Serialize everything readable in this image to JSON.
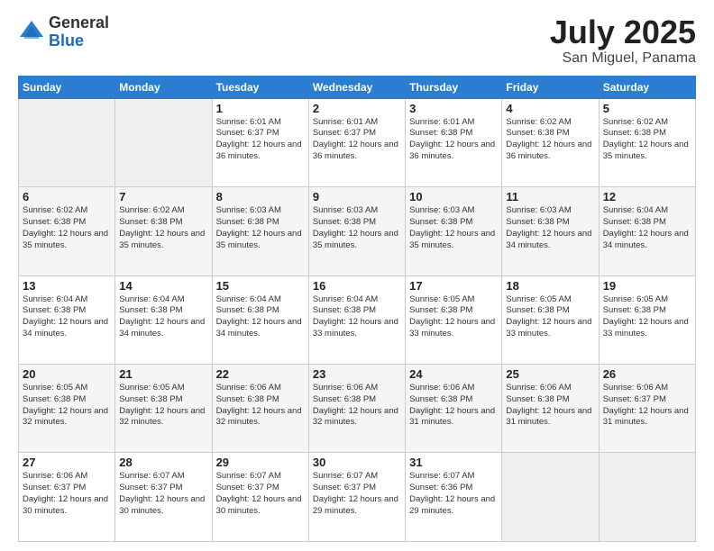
{
  "header": {
    "logo_general": "General",
    "logo_blue": "Blue",
    "title": "July 2025",
    "location": "San Miguel, Panama"
  },
  "weekdays": [
    "Sunday",
    "Monday",
    "Tuesday",
    "Wednesday",
    "Thursday",
    "Friday",
    "Saturday"
  ],
  "weeks": [
    [
      {
        "day": "",
        "sunrise": "",
        "sunset": "",
        "daylight": "",
        "empty": true
      },
      {
        "day": "",
        "sunrise": "",
        "sunset": "",
        "daylight": "",
        "empty": true
      },
      {
        "day": "1",
        "sunrise": "Sunrise: 6:01 AM",
        "sunset": "Sunset: 6:37 PM",
        "daylight": "Daylight: 12 hours and 36 minutes."
      },
      {
        "day": "2",
        "sunrise": "Sunrise: 6:01 AM",
        "sunset": "Sunset: 6:37 PM",
        "daylight": "Daylight: 12 hours and 36 minutes."
      },
      {
        "day": "3",
        "sunrise": "Sunrise: 6:01 AM",
        "sunset": "Sunset: 6:38 PM",
        "daylight": "Daylight: 12 hours and 36 minutes."
      },
      {
        "day": "4",
        "sunrise": "Sunrise: 6:02 AM",
        "sunset": "Sunset: 6:38 PM",
        "daylight": "Daylight: 12 hours and 36 minutes."
      },
      {
        "day": "5",
        "sunrise": "Sunrise: 6:02 AM",
        "sunset": "Sunset: 6:38 PM",
        "daylight": "Daylight: 12 hours and 35 minutes."
      }
    ],
    [
      {
        "day": "6",
        "sunrise": "Sunrise: 6:02 AM",
        "sunset": "Sunset: 6:38 PM",
        "daylight": "Daylight: 12 hours and 35 minutes."
      },
      {
        "day": "7",
        "sunrise": "Sunrise: 6:02 AM",
        "sunset": "Sunset: 6:38 PM",
        "daylight": "Daylight: 12 hours and 35 minutes."
      },
      {
        "day": "8",
        "sunrise": "Sunrise: 6:03 AM",
        "sunset": "Sunset: 6:38 PM",
        "daylight": "Daylight: 12 hours and 35 minutes."
      },
      {
        "day": "9",
        "sunrise": "Sunrise: 6:03 AM",
        "sunset": "Sunset: 6:38 PM",
        "daylight": "Daylight: 12 hours and 35 minutes."
      },
      {
        "day": "10",
        "sunrise": "Sunrise: 6:03 AM",
        "sunset": "Sunset: 6:38 PM",
        "daylight": "Daylight: 12 hours and 35 minutes."
      },
      {
        "day": "11",
        "sunrise": "Sunrise: 6:03 AM",
        "sunset": "Sunset: 6:38 PM",
        "daylight": "Daylight: 12 hours and 34 minutes."
      },
      {
        "day": "12",
        "sunrise": "Sunrise: 6:04 AM",
        "sunset": "Sunset: 6:38 PM",
        "daylight": "Daylight: 12 hours and 34 minutes."
      }
    ],
    [
      {
        "day": "13",
        "sunrise": "Sunrise: 6:04 AM",
        "sunset": "Sunset: 6:38 PM",
        "daylight": "Daylight: 12 hours and 34 minutes."
      },
      {
        "day": "14",
        "sunrise": "Sunrise: 6:04 AM",
        "sunset": "Sunset: 6:38 PM",
        "daylight": "Daylight: 12 hours and 34 minutes."
      },
      {
        "day": "15",
        "sunrise": "Sunrise: 6:04 AM",
        "sunset": "Sunset: 6:38 PM",
        "daylight": "Daylight: 12 hours and 34 minutes."
      },
      {
        "day": "16",
        "sunrise": "Sunrise: 6:04 AM",
        "sunset": "Sunset: 6:38 PM",
        "daylight": "Daylight: 12 hours and 33 minutes."
      },
      {
        "day": "17",
        "sunrise": "Sunrise: 6:05 AM",
        "sunset": "Sunset: 6:38 PM",
        "daylight": "Daylight: 12 hours and 33 minutes."
      },
      {
        "day": "18",
        "sunrise": "Sunrise: 6:05 AM",
        "sunset": "Sunset: 6:38 PM",
        "daylight": "Daylight: 12 hours and 33 minutes."
      },
      {
        "day": "19",
        "sunrise": "Sunrise: 6:05 AM",
        "sunset": "Sunset: 6:38 PM",
        "daylight": "Daylight: 12 hours and 33 minutes."
      }
    ],
    [
      {
        "day": "20",
        "sunrise": "Sunrise: 6:05 AM",
        "sunset": "Sunset: 6:38 PM",
        "daylight": "Daylight: 12 hours and 32 minutes."
      },
      {
        "day": "21",
        "sunrise": "Sunrise: 6:05 AM",
        "sunset": "Sunset: 6:38 PM",
        "daylight": "Daylight: 12 hours and 32 minutes."
      },
      {
        "day": "22",
        "sunrise": "Sunrise: 6:06 AM",
        "sunset": "Sunset: 6:38 PM",
        "daylight": "Daylight: 12 hours and 32 minutes."
      },
      {
        "day": "23",
        "sunrise": "Sunrise: 6:06 AM",
        "sunset": "Sunset: 6:38 PM",
        "daylight": "Daylight: 12 hours and 32 minutes."
      },
      {
        "day": "24",
        "sunrise": "Sunrise: 6:06 AM",
        "sunset": "Sunset: 6:38 PM",
        "daylight": "Daylight: 12 hours and 31 minutes."
      },
      {
        "day": "25",
        "sunrise": "Sunrise: 6:06 AM",
        "sunset": "Sunset: 6:38 PM",
        "daylight": "Daylight: 12 hours and 31 minutes."
      },
      {
        "day": "26",
        "sunrise": "Sunrise: 6:06 AM",
        "sunset": "Sunset: 6:37 PM",
        "daylight": "Daylight: 12 hours and 31 minutes."
      }
    ],
    [
      {
        "day": "27",
        "sunrise": "Sunrise: 6:06 AM",
        "sunset": "Sunset: 6:37 PM",
        "daylight": "Daylight: 12 hours and 30 minutes."
      },
      {
        "day": "28",
        "sunrise": "Sunrise: 6:07 AM",
        "sunset": "Sunset: 6:37 PM",
        "daylight": "Daylight: 12 hours and 30 minutes."
      },
      {
        "day": "29",
        "sunrise": "Sunrise: 6:07 AM",
        "sunset": "Sunset: 6:37 PM",
        "daylight": "Daylight: 12 hours and 30 minutes."
      },
      {
        "day": "30",
        "sunrise": "Sunrise: 6:07 AM",
        "sunset": "Sunset: 6:37 PM",
        "daylight": "Daylight: 12 hours and 29 minutes."
      },
      {
        "day": "31",
        "sunrise": "Sunrise: 6:07 AM",
        "sunset": "Sunset: 6:36 PM",
        "daylight": "Daylight: 12 hours and 29 minutes."
      },
      {
        "day": "",
        "sunrise": "",
        "sunset": "",
        "daylight": "",
        "empty": true
      },
      {
        "day": "",
        "sunrise": "",
        "sunset": "",
        "daylight": "",
        "empty": true
      }
    ]
  ]
}
